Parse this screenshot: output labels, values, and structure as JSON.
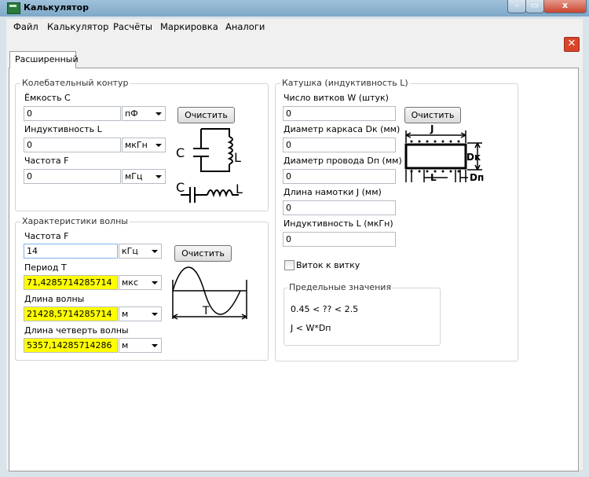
{
  "window": {
    "title": "Калькулятор",
    "min_glyph": "–",
    "max_glyph": "▭",
    "close_glyph": "x"
  },
  "menu": [
    "Файл",
    "Калькулятор",
    "Расчёты",
    "Маркировка",
    "Аналоги"
  ],
  "tabs": {
    "close_glyph": "✕",
    "active": "Расширенный"
  },
  "circuit": {
    "title": "Колебательный контур",
    "capacitance": {
      "label": "Ёмкость C",
      "value": "0",
      "unit": "пФ"
    },
    "inductance": {
      "label": "Индуктивность L",
      "value": "0",
      "unit": "мкГн"
    },
    "frequency": {
      "label": "Частота F",
      "value": "0",
      "unit": "мГц"
    },
    "clear": "Очистить",
    "diagram": {
      "c_label": "C",
      "l_label": "L"
    }
  },
  "wave": {
    "title": "Характеристики волны",
    "frequency": {
      "label": "Частота F",
      "value": "14",
      "unit": "кГц"
    },
    "period": {
      "label": "Период T",
      "value": "71,4285714285714",
      "unit": "мкс"
    },
    "wavelength": {
      "label": "Длина волны",
      "value": "21428,5714285714",
      "unit": "м"
    },
    "quarter": {
      "label": "Длина четверть волны",
      "value": "5357,14285714286",
      "unit": "м"
    },
    "clear": "Очистить",
    "diagram": {
      "t_label": "T"
    }
  },
  "coil": {
    "title": "Катушка (индуктивность L)",
    "turns": {
      "label": "Число витков W (штук)",
      "value": "0"
    },
    "frame_diameter": {
      "label": "Диаметр каркаса Dк (мм)",
      "value": "0"
    },
    "wire_diameter": {
      "label": "Диаметр провода Dп (мм)",
      "value": "0"
    },
    "winding_length": {
      "label": "Длина намотки J (мм)",
      "value": "0"
    },
    "inductance": {
      "label": "Индуктивность L (мкГн)",
      "value": "0"
    },
    "clear": "Очистить",
    "turn_to_turn": "Виток к витку",
    "diagram": {
      "j": "J",
      "dk": "Dк",
      "l": "L",
      "dp": "Dп"
    },
    "limits": {
      "title": "Предельные значения",
      "line1": "0.45 < ?? < 2.5",
      "line2": "J < W*Dп"
    }
  }
}
